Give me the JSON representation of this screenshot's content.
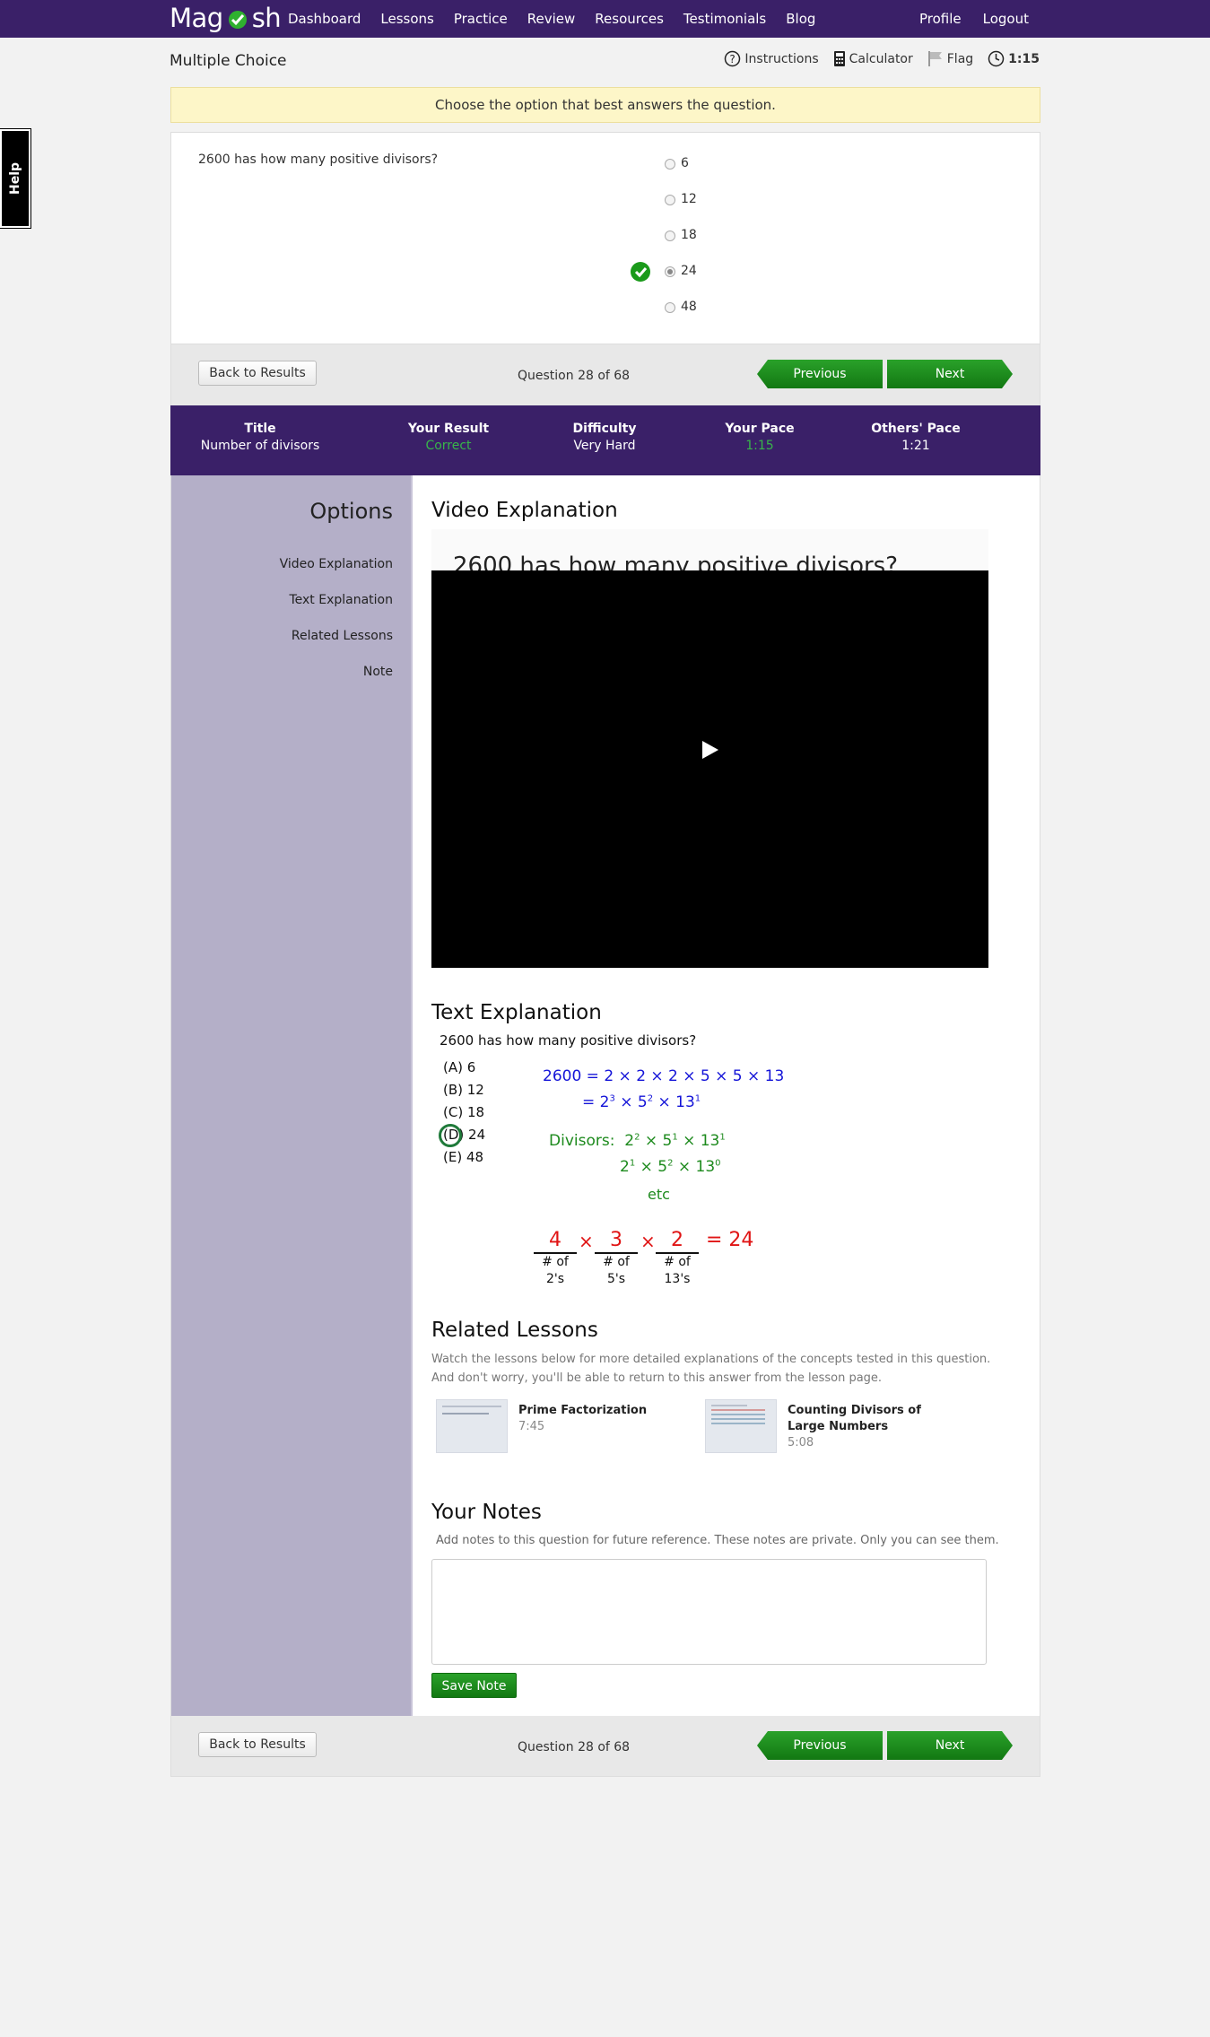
{
  "brand": {
    "logo_prefix": "Mag",
    "logo_suffix": "sh"
  },
  "nav": {
    "links": [
      "Dashboard",
      "Lessons",
      "Practice",
      "Review",
      "Resources",
      "Testimonials",
      "Blog"
    ],
    "right": [
      "Profile",
      "Logout"
    ]
  },
  "header": {
    "title": "Multiple Choice",
    "tools": {
      "instructions": "Instructions",
      "calculator": "Calculator",
      "flag": "Flag",
      "timer": "1:15"
    }
  },
  "help_tab": "Help",
  "banner": "Choose the option that best answers the question.",
  "question": {
    "text": "2600 has how many positive divisors?",
    "options": [
      "6",
      "12",
      "18",
      "24",
      "48"
    ],
    "selected_index": 3,
    "correct_index": 3
  },
  "navbar": {
    "back": "Back to Results",
    "count": "Question 28 of 68",
    "previous": "Previous",
    "next": "Next"
  },
  "stats": [
    {
      "label": "Title",
      "value": "Number of divisors"
    },
    {
      "label": "Your Result",
      "value": "Correct"
    },
    {
      "label": "Difficulty",
      "value": "Very Hard"
    },
    {
      "label": "Your Pace",
      "value": "1:15"
    },
    {
      "label": "Others' Pace",
      "value": "1:21"
    }
  ],
  "sidebar": {
    "title": "Options",
    "items": [
      "Video Explanation",
      "Text Explanation",
      "Related Lessons",
      "Note"
    ]
  },
  "video": {
    "heading": "Video Explanation",
    "frame_text": "2600 has how many positive divisors?"
  },
  "text_explanation": {
    "heading": "Text Explanation",
    "question": "2600 has how many positive divisors?",
    "choices": [
      "(A) 6",
      "(B) 12",
      "(C) 18",
      "(D) 24",
      "(E) 48"
    ],
    "circled_choice_letter": "D",
    "circled_choice_rest": " 24",
    "factor_line1_lhs": "2600",
    "factor_line1_rhs": "= 2 × 2 × 2 × 5 × 5 × 13",
    "factor_line2_eq": "=",
    "divisors_label": "Divisors:",
    "etc": "etc",
    "blanks": [
      {
        "value": "4",
        "label1": "# of",
        "label2": "2's"
      },
      {
        "value": "3",
        "label1": "# of",
        "label2": "5's"
      },
      {
        "value": "2",
        "label1": "# of",
        "label2": "13's"
      }
    ],
    "times": "×",
    "result": "= 24"
  },
  "related": {
    "heading": "Related Lessons",
    "desc1": "Watch the lessons below for more detailed explanations of the concepts tested in this question.",
    "desc2": "And don't worry, you'll be able to return to this answer from the lesson page.",
    "lessons": [
      {
        "title_line1": "Prime Factorization",
        "title_line2": "",
        "duration": "7:45"
      },
      {
        "title_line1": "Counting Divisors of",
        "title_line2": "Large Numbers",
        "duration": "5:08"
      }
    ]
  },
  "notes": {
    "heading": "Your Notes",
    "desc": "Add notes to this question for future reference. These notes are private. Only you can see them.",
    "value": "",
    "save": "Save Note"
  },
  "colors": {
    "nav_purple": "#3a2068",
    "accent_green": "#1b9a1b",
    "sidebar_lavender": "#b4afc8",
    "banner_yellow": "#fdf6c8"
  }
}
